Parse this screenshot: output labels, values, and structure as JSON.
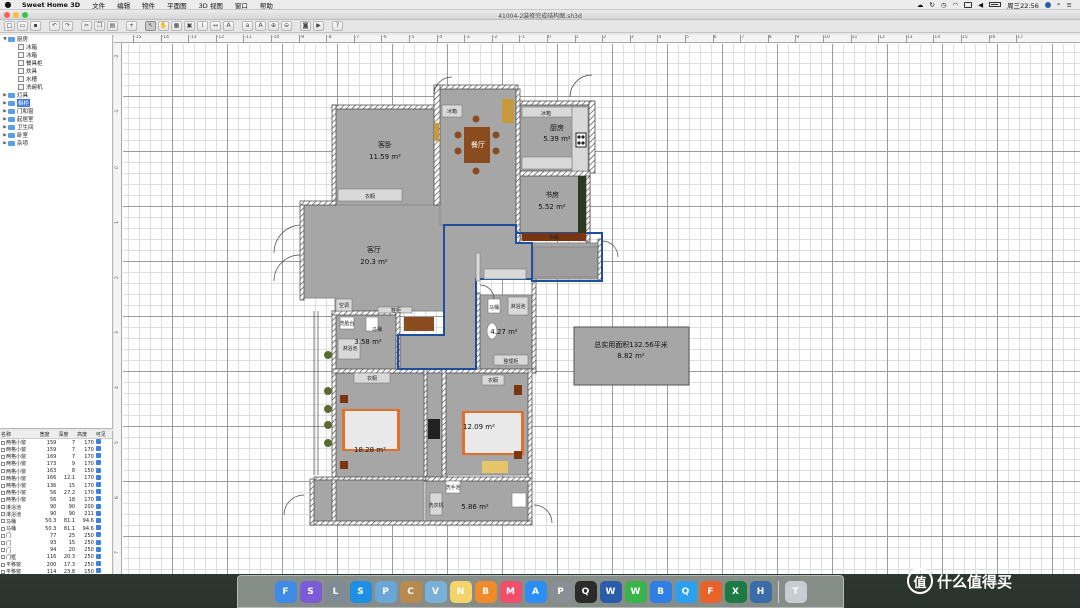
{
  "menubar": {
    "items": [
      "Sweet Home 3D",
      "文件",
      "编辑",
      "物件",
      "平面图",
      "3D 视图",
      "窗口",
      "帮助"
    ],
    "clock": "周三22:56"
  },
  "window": {
    "title": "41004-2装修完成结构图.sh3d"
  },
  "catalog": {
    "rows": [
      {
        "label": "厨房",
        "kind": "folder",
        "expanded": true,
        "indent": 0
      },
      {
        "label": "冰箱",
        "kind": "item",
        "indent": 1
      },
      {
        "label": "冰箱",
        "kind": "item",
        "indent": 1
      },
      {
        "label": "餐具柜",
        "kind": "item",
        "indent": 1
      },
      {
        "label": "炊具",
        "kind": "item",
        "indent": 1
      },
      {
        "label": "水槽",
        "kind": "item",
        "indent": 1
      },
      {
        "label": "洗碗机",
        "kind": "item",
        "indent": 1
      },
      {
        "label": "灯具",
        "kind": "folder",
        "indent": 0
      },
      {
        "label": "橱柜",
        "kind": "folder",
        "indent": 0,
        "selected": true
      },
      {
        "label": "门和窗",
        "kind": "folder",
        "indent": 0
      },
      {
        "label": "起居室",
        "kind": "folder",
        "indent": 0
      },
      {
        "label": "卫生间",
        "kind": "folder",
        "indent": 0
      },
      {
        "label": "卧室",
        "kind": "folder",
        "indent": 0
      },
      {
        "label": "杂项",
        "kind": "folder",
        "indent": 0
      }
    ]
  },
  "furniture_table": {
    "headers": [
      "名称",
      "宽度",
      "深度",
      "高度",
      "可见"
    ],
    "rows": [
      [
        "两格小窗",
        "159",
        "7",
        "170"
      ],
      [
        "两格小窗",
        "159",
        "7",
        "170"
      ],
      [
        "两格小窗",
        "169",
        "7",
        "170"
      ],
      [
        "两格小窗",
        "173",
        "9",
        "170"
      ],
      [
        "两格小窗",
        "163",
        "8",
        "150"
      ],
      [
        "两格小窗",
        "166",
        "12.1",
        "170"
      ],
      [
        "两格小窗",
        "136",
        "15",
        "170"
      ],
      [
        "两格小窗",
        "56",
        "27.2",
        "170"
      ],
      [
        "两格小窗",
        "56",
        "18",
        "170"
      ],
      [
        "淋浴池",
        "90",
        "90",
        "200"
      ],
      [
        "淋浴池",
        "90",
        "90",
        "211"
      ],
      [
        "马桶",
        "50.3",
        "81.1",
        "94.6"
      ],
      [
        "马桶",
        "50.3",
        "81.1",
        "94.6"
      ],
      [
        "门",
        "77",
        "25",
        "250"
      ],
      [
        "门",
        "93",
        "15",
        "250"
      ],
      [
        "门",
        "94",
        "20",
        "250"
      ],
      [
        "门框",
        "116",
        "20.3",
        "250"
      ],
      [
        "平移窗",
        "200",
        "17.3",
        "250"
      ],
      [
        "平移窗",
        "114",
        "23.8",
        "150"
      ],
      [
        "洞洞",
        "120",
        "33",
        "134"
      ]
    ]
  },
  "ruler": {
    "top_ticks": [
      "-15",
      "-14",
      "-13",
      "-12",
      "-11",
      "-10",
      "-9",
      "-8",
      "-7",
      "-6",
      "-5",
      "-4",
      "-3",
      "-2",
      "-1",
      "0",
      "1",
      "2",
      "3",
      "4",
      "5",
      "6",
      "7",
      "8",
      "9",
      "10",
      "11",
      "12",
      "13",
      "14",
      "15",
      "16",
      "17"
    ],
    "left_ticks": [
      "-2",
      "-1",
      "0",
      "1",
      "2",
      "3",
      "4",
      "5",
      "6",
      "7",
      "8"
    ]
  },
  "plan": {
    "colors": {
      "room": "#a6a6a6",
      "wall": "#545454",
      "selected": "#1f4e9c",
      "wood": "#8a4b1f",
      "bed_frame": "#e0702a"
    },
    "rooms": [
      {
        "id": "guest-bedroom",
        "name": "客卧",
        "area": "11.59 m²"
      },
      {
        "id": "dining",
        "name": "餐厅",
        "area": "11.9 m²"
      },
      {
        "id": "kitchen",
        "name": "厨房",
        "area": "5.39 m²"
      },
      {
        "id": "study",
        "name": "书房",
        "area": "5.52 m²"
      },
      {
        "id": "living",
        "name": "客厅",
        "area": "20.3 m²"
      },
      {
        "id": "bath-1",
        "name": "",
        "area": "3.58 m²"
      },
      {
        "id": "bath-2",
        "name": "",
        "area": "4.27 m²"
      },
      {
        "id": "master-bedroom",
        "name": "",
        "area": "18.28 m²"
      },
      {
        "id": "second-bedroom",
        "name": "",
        "area": "12.09 m²"
      },
      {
        "id": "balcony",
        "name": "",
        "area": "5.86 m²"
      }
    ],
    "furniture_labels": {
      "fridge_1": "冰箱",
      "fridge_2": "冰箱",
      "wardrobe_1": "衣橱",
      "wardrobe_2": "衣橱",
      "wardrobe_3": "衣橱",
      "wardrobe_4": "衣橱",
      "ac": "空调",
      "shoe_cabinet": "鞋柜",
      "toilet_1": "马桶",
      "toilet_2": "马桶",
      "shower_1": "淋浴池",
      "shower_2": "淋浴池",
      "sink_1": "洗脸台",
      "washstand": "洗手池",
      "washing_machine": "洗衣机",
      "combo_cabinet": "整理柜"
    },
    "summary": {
      "line1": "总实用面积132.56平米",
      "line2": "8.82 m²"
    }
  },
  "dock": {
    "apps": [
      {
        "name": "finder",
        "color": "#3d8be6",
        "glyph": "F"
      },
      {
        "name": "siri",
        "color": "#7c5cd6",
        "glyph": "S"
      },
      {
        "name": "launchpad",
        "color": "#7f8c95",
        "glyph": "L"
      },
      {
        "name": "safari",
        "color": "#1f8fe4",
        "glyph": "S"
      },
      {
        "name": "photos",
        "color": "#6aa6d8",
        "glyph": "P"
      },
      {
        "name": "contacts",
        "color": "#b88a52",
        "glyph": "C"
      },
      {
        "name": "preview",
        "color": "#7ab0d8",
        "glyph": "V"
      },
      {
        "name": "notes",
        "color": "#f3d36b",
        "glyph": "N"
      },
      {
        "name": "books",
        "color": "#f08a2a",
        "glyph": "B"
      },
      {
        "name": "music",
        "color": "#f04f6b",
        "glyph": "M"
      },
      {
        "name": "app-store",
        "color": "#2a8ef3",
        "glyph": "A"
      },
      {
        "name": "system-preferences",
        "color": "#8a8f93",
        "glyph": "P"
      },
      {
        "name": "qq",
        "color": "#2b2b2b",
        "glyph": "Q"
      },
      {
        "name": "word",
        "color": "#2a5caa",
        "glyph": "W"
      },
      {
        "name": "wechat",
        "color": "#3ab34a",
        "glyph": "W"
      },
      {
        "name": "baidu-netdisk",
        "color": "#2f7ee6",
        "glyph": "B"
      },
      {
        "name": "qq-browser",
        "color": "#2aa0ee",
        "glyph": "Q"
      },
      {
        "name": "firefox",
        "color": "#e8622a",
        "glyph": "F"
      },
      {
        "name": "excel",
        "color": "#1d7a45",
        "glyph": "X"
      },
      {
        "name": "sweet-home-3d",
        "color": "#3a6da8",
        "glyph": "H"
      },
      {
        "name": "trash",
        "color": "#c8cdd1",
        "glyph": "T"
      }
    ]
  },
  "watermark": {
    "badge": "值",
    "text": "什么值得买"
  }
}
